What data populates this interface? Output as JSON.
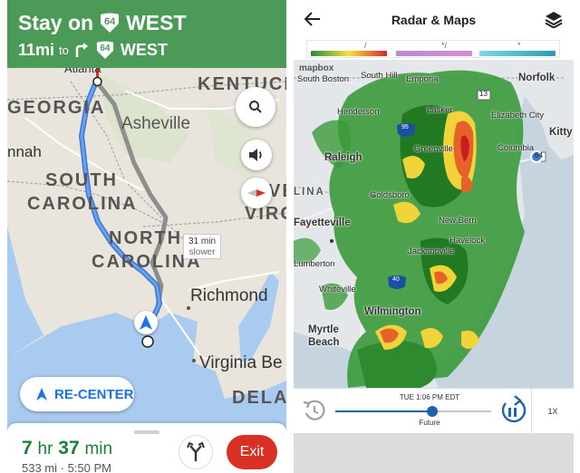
{
  "navigation": {
    "banner": {
      "instruction_prefix": "Stay on",
      "route_number": "64",
      "direction": "WEST",
      "distance": "11mi",
      "to_word": "to",
      "next_route_number": "64",
      "next_direction": "WEST"
    },
    "map_labels": {
      "atlanta": "Atlanta",
      "kentucky": "KENTUCK",
      "georgia": "GEORGIA",
      "asheville": "Asheville",
      "savannah": "nnah",
      "south_carolina_1": "SOUTH",
      "south_carolina_2": "CAROLINA",
      "north_carolina_1": "NORTH",
      "north_carolina_2": "CAROLINA",
      "virginia_edge_1": "VE",
      "virginia_edge_2": "VIRG",
      "richmond": "Richmond",
      "virginia_beach": "Virginia Be",
      "delaware": "DELA"
    },
    "delay_badge": {
      "time": "31 min",
      "note": "slower"
    },
    "recenter_label": "RE-CENTER",
    "eta": {
      "hours": "7",
      "hr_unit": "hr",
      "minutes": "37",
      "min_unit": "min"
    },
    "eta_subtitle": "533 mi · 5:50 PM",
    "exit_label": "Exit",
    "colors": {
      "banner": "#4b9a57",
      "route": "#4a84e0",
      "alt_route": "#9e9e9e",
      "eta": "#188038",
      "exit": "#d93025"
    }
  },
  "radar": {
    "title": "Radar & Maps",
    "attribution": "mapbox",
    "legend": [
      {
        "name": "rain",
        "icon": "rain-icon",
        "colors": [
          "#2f8a3a",
          "#f5e13b",
          "#d9262b"
        ]
      },
      {
        "name": "mix",
        "icon": "mix-icon",
        "colors": [
          "#b98ad6",
          "#d48ed2"
        ]
      },
      {
        "name": "snow",
        "icon": "snow-icon",
        "colors": [
          "#79d7e6",
          "#2e9bb0"
        ]
      }
    ],
    "place_labels": {
      "south_boston": "South Boston",
      "south_hill": "South Hill",
      "emporia": "Emporia",
      "norfolk": "Norfolk",
      "henderson": "Henderson",
      "lasker": "Lasker",
      "elizabeth_city": "Elizabeth City",
      "kitty_hawk": "Kitty Ha",
      "columbia": "Columbia",
      "raleigh": "Raleigh",
      "greenville": "Greenville",
      "goldsboro": "Goldsboro",
      "lina": "LINA",
      "fayetteville": "Fayetteville",
      "new_bern": "New Bern",
      "havelock": "Havelock",
      "jacksonville": "Jacksonville",
      "lumberton": "Lumberton",
      "whiteville": "Whiteville",
      "wilmington": "Wilmington",
      "myrtle_beach_1": "Myrtle",
      "myrtle_beach_2": "Beach",
      "route_95": "95",
      "route_40": "40",
      "route_13": "13",
      "route_64": "64"
    },
    "timeline": {
      "timestamp": "TUE 1:06 PM EDT",
      "mode_label": "Future",
      "progress": 0.62,
      "speed": "1X"
    }
  }
}
